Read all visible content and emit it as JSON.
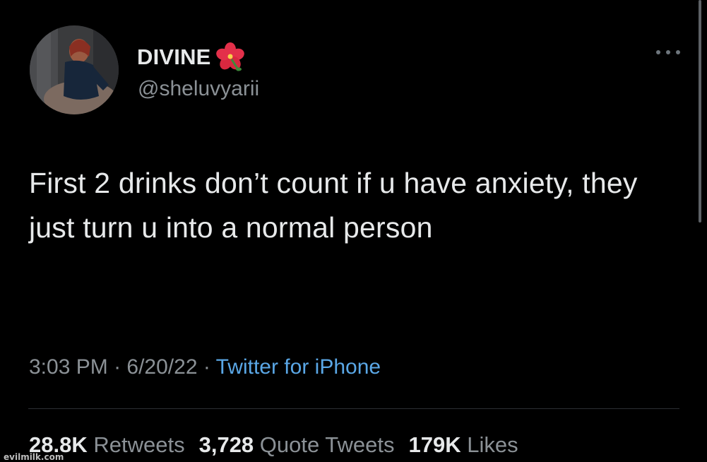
{
  "author": {
    "display_name": "DIVINE",
    "handle": "@sheluvyarii",
    "badge_icon": "hibiscus-icon"
  },
  "tweet": {
    "text": "First 2 drinks don’t count if u have anxiety, they just turn u into a normal person"
  },
  "meta": {
    "time": "3:03 PM",
    "separator": " · ",
    "date": "6/20/22",
    "source": "Twitter for iPhone"
  },
  "stats": {
    "retweets_count": "28.8K",
    "retweets_label": "Retweets",
    "quotes_count": "3,728",
    "quotes_label": "Quote Tweets",
    "likes_count": "179K",
    "likes_label": "Likes"
  },
  "watermark": "evilmilk.com",
  "colors": {
    "background": "#000000",
    "primary_text": "#e7e9ea",
    "secondary_text": "#8b9196",
    "link": "#5aa7e6"
  }
}
